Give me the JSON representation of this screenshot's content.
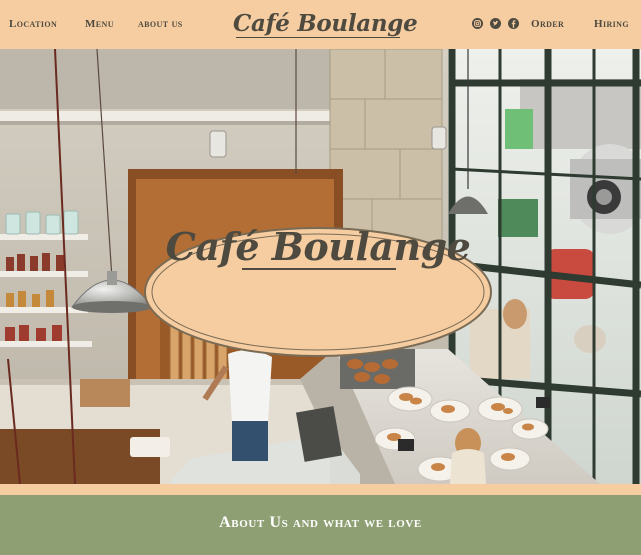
{
  "header": {
    "nav_left": [
      "Location",
      "Menu",
      "about us"
    ],
    "brand": "Café Boulange",
    "social_icons": [
      "instagram-icon",
      "twitter-icon",
      "facebook-icon"
    ],
    "nav_right": [
      "Order",
      "Hiring"
    ]
  },
  "hero": {
    "emblem_title": "Café Boulange",
    "image_description_icon": "cafe-interior-photo"
  },
  "about": {
    "title": "About Us and what we love"
  },
  "colors": {
    "header_bg": "#f6cda1",
    "text": "#4e4a3f",
    "emblem_fill": "#f6cda1",
    "about_bg": "#8e9f73",
    "about_text": "#ffffff"
  }
}
